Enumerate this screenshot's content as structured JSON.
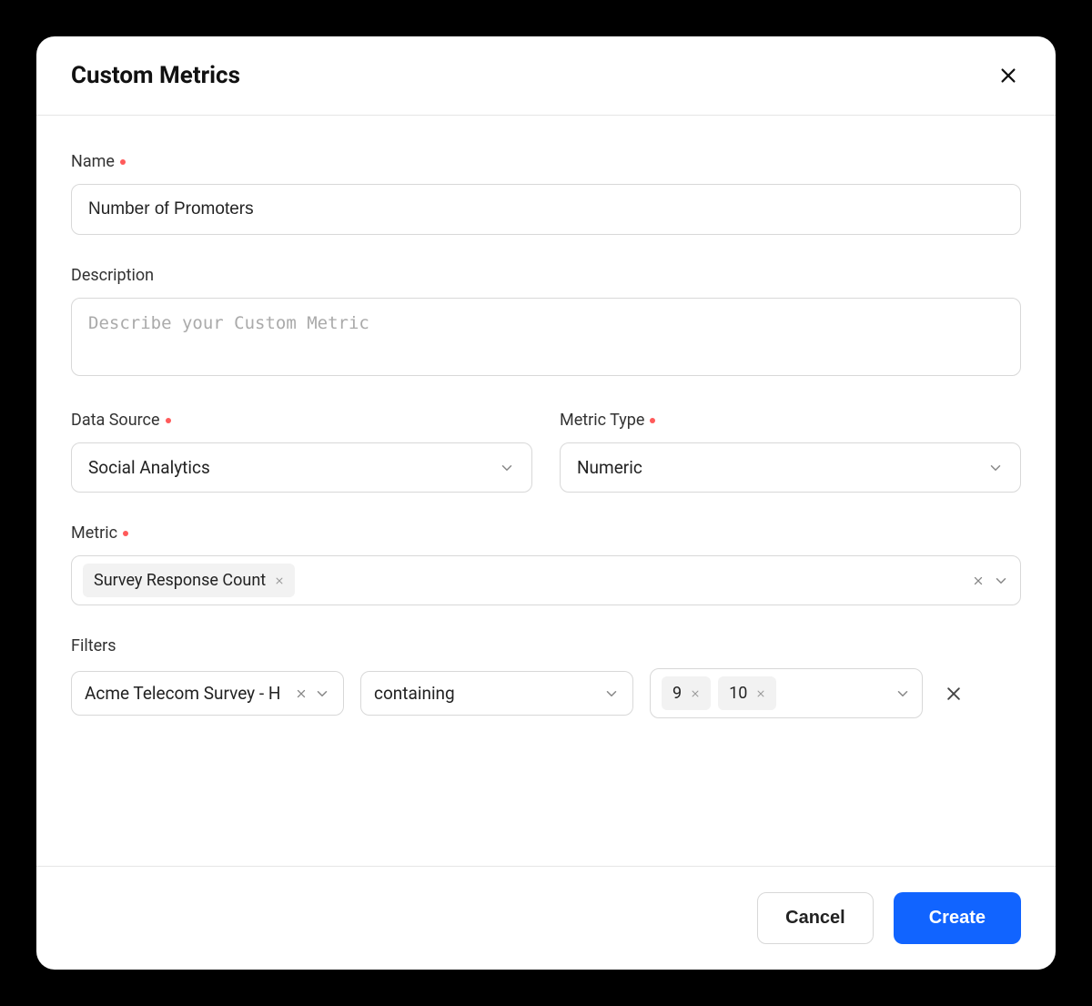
{
  "modal": {
    "title": "Custom Metrics"
  },
  "fields": {
    "name": {
      "label": "Name",
      "value": "Number of Promoters"
    },
    "description": {
      "label": "Description",
      "placeholder": "Describe your Custom Metric"
    },
    "dataSource": {
      "label": "Data Source",
      "value": "Social Analytics"
    },
    "metricType": {
      "label": "Metric Type",
      "value": "Numeric"
    },
    "metric": {
      "label": "Metric",
      "chips": [
        "Survey Response Count"
      ]
    },
    "filters": {
      "label": "Filters",
      "rows": [
        {
          "field": "Acme Telecom Survey - H",
          "operator": "containing",
          "values": [
            "9",
            "10"
          ]
        }
      ]
    }
  },
  "footer": {
    "cancel": "Cancel",
    "create": "Create"
  }
}
